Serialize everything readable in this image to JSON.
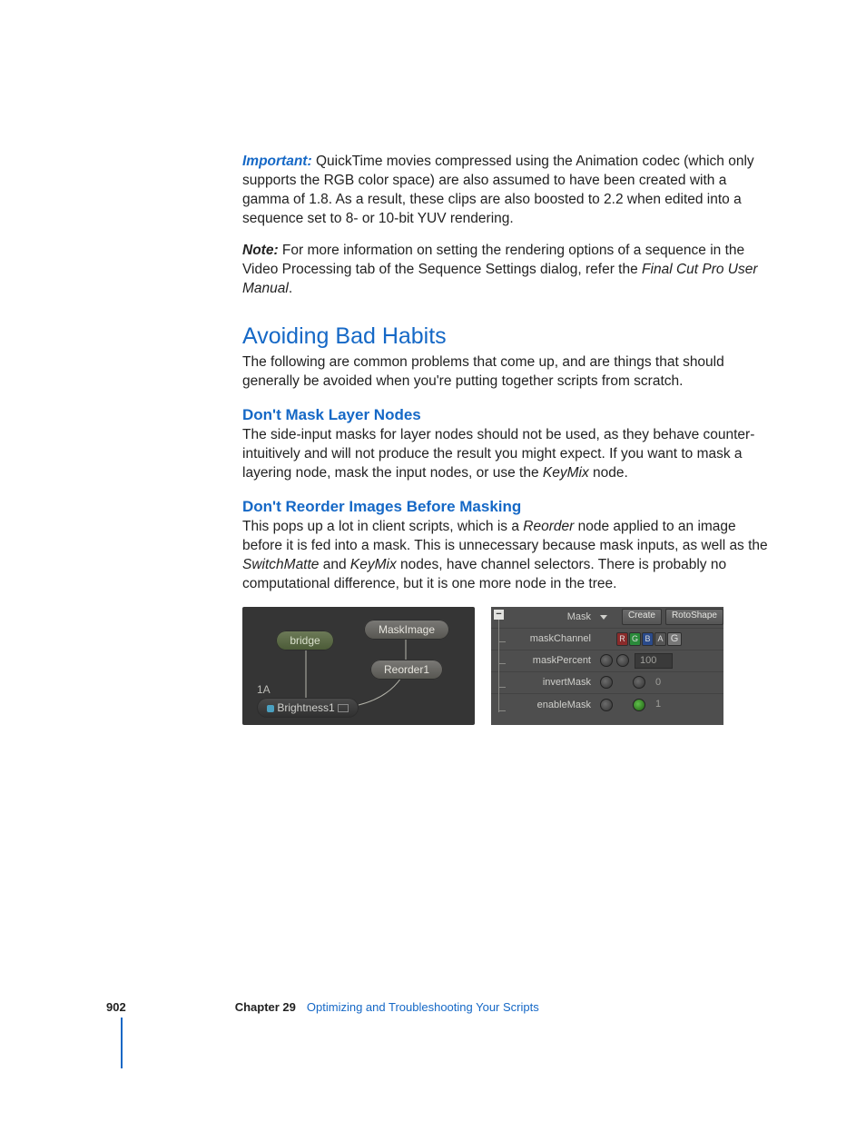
{
  "paragraphs": {
    "important_label": "Important:",
    "important_text": "  QuickTime movies compressed using the Animation codec (which only supports the RGB color space) are also assumed to have been created with a gamma of 1.8. As a result, these clips are also boosted to 2.2 when edited into a sequence set to 8- or 10-bit YUV rendering.",
    "note_label": "Note:",
    "note_text_a": "  For more information on setting the rendering options of a sequence in the Video Processing tab of the Sequence Settings dialog, refer the ",
    "note_text_ital": "Final Cut Pro User Manual",
    "note_text_b": "."
  },
  "section": {
    "heading": "Avoiding Bad Habits",
    "intro": "The following are common problems that come up, and are things that should generally be avoided when you're putting together scripts from scratch."
  },
  "sub1": {
    "heading": "Don't Mask Layer Nodes",
    "text_a": "The side-input masks for layer nodes should not be used, as they behave counter-intuitively and will not produce the result you might expect. If you want to mask a layering node, mask the input nodes, or use the ",
    "ital": "KeyMix",
    "text_b": " node."
  },
  "sub2": {
    "heading": "Don't Reorder Images Before Masking",
    "text_a": "This pops up a lot in client scripts, which is a ",
    "ital1": "Reorder",
    "text_b": " node applied to an image before it is fed into a mask. This is unnecessary because mask inputs, as well as the ",
    "ital2": "SwitchMatte",
    "text_c": " and ",
    "ital3": "KeyMix",
    "text_d": " nodes, have channel selectors. There is probably no computational difference, but it is one more node in the tree."
  },
  "graph": {
    "node_bridge": "bridge",
    "node_maskimage": "MaskImage",
    "node_reorder": "Reorder1",
    "node_brightness": "Brightness1",
    "label_1a": "1A"
  },
  "panel": {
    "row_mask": "Mask",
    "btn_create": "Create",
    "btn_rotoshape": "RotoShape",
    "row_maskchannel": "maskChannel",
    "chan_r": "R",
    "chan_g": "G",
    "chan_b": "B",
    "chan_a": "A",
    "chan_sel": "G",
    "row_maskpercent": "maskPercent",
    "val_percent": "100",
    "row_invertmask": "invertMask",
    "val_invert": "0",
    "row_enablemask": "enableMask",
    "val_enable": "1"
  },
  "footer": {
    "page": "902",
    "chapter_label": "Chapter 29",
    "chapter_title": "Optimizing and Troubleshooting Your Scripts"
  }
}
